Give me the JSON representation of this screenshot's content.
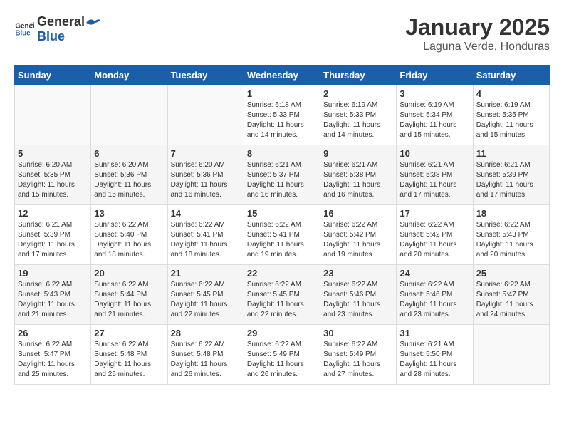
{
  "header": {
    "logo_general": "General",
    "logo_blue": "Blue",
    "month": "January 2025",
    "location": "Laguna Verde, Honduras"
  },
  "weekdays": [
    "Sunday",
    "Monday",
    "Tuesday",
    "Wednesday",
    "Thursday",
    "Friday",
    "Saturday"
  ],
  "weeks": [
    [
      {
        "day": "",
        "info": ""
      },
      {
        "day": "",
        "info": ""
      },
      {
        "day": "",
        "info": ""
      },
      {
        "day": "1",
        "info": "Sunrise: 6:18 AM\nSunset: 5:33 PM\nDaylight: 11 hours\nand 14 minutes."
      },
      {
        "day": "2",
        "info": "Sunrise: 6:19 AM\nSunset: 5:33 PM\nDaylight: 11 hours\nand 14 minutes."
      },
      {
        "day": "3",
        "info": "Sunrise: 6:19 AM\nSunset: 5:34 PM\nDaylight: 11 hours\nand 15 minutes."
      },
      {
        "day": "4",
        "info": "Sunrise: 6:19 AM\nSunset: 5:35 PM\nDaylight: 11 hours\nand 15 minutes."
      }
    ],
    [
      {
        "day": "5",
        "info": "Sunrise: 6:20 AM\nSunset: 5:35 PM\nDaylight: 11 hours\nand 15 minutes."
      },
      {
        "day": "6",
        "info": "Sunrise: 6:20 AM\nSunset: 5:36 PM\nDaylight: 11 hours\nand 15 minutes."
      },
      {
        "day": "7",
        "info": "Sunrise: 6:20 AM\nSunset: 5:36 PM\nDaylight: 11 hours\nand 16 minutes."
      },
      {
        "day": "8",
        "info": "Sunrise: 6:21 AM\nSunset: 5:37 PM\nDaylight: 11 hours\nand 16 minutes."
      },
      {
        "day": "9",
        "info": "Sunrise: 6:21 AM\nSunset: 5:38 PM\nDaylight: 11 hours\nand 16 minutes."
      },
      {
        "day": "10",
        "info": "Sunrise: 6:21 AM\nSunset: 5:38 PM\nDaylight: 11 hours\nand 17 minutes."
      },
      {
        "day": "11",
        "info": "Sunrise: 6:21 AM\nSunset: 5:39 PM\nDaylight: 11 hours\nand 17 minutes."
      }
    ],
    [
      {
        "day": "12",
        "info": "Sunrise: 6:21 AM\nSunset: 5:39 PM\nDaylight: 11 hours\nand 17 minutes."
      },
      {
        "day": "13",
        "info": "Sunrise: 6:22 AM\nSunset: 5:40 PM\nDaylight: 11 hours\nand 18 minutes."
      },
      {
        "day": "14",
        "info": "Sunrise: 6:22 AM\nSunset: 5:41 PM\nDaylight: 11 hours\nand 18 minutes."
      },
      {
        "day": "15",
        "info": "Sunrise: 6:22 AM\nSunset: 5:41 PM\nDaylight: 11 hours\nand 19 minutes."
      },
      {
        "day": "16",
        "info": "Sunrise: 6:22 AM\nSunset: 5:42 PM\nDaylight: 11 hours\nand 19 minutes."
      },
      {
        "day": "17",
        "info": "Sunrise: 6:22 AM\nSunset: 5:42 PM\nDaylight: 11 hours\nand 20 minutes."
      },
      {
        "day": "18",
        "info": "Sunrise: 6:22 AM\nSunset: 5:43 PM\nDaylight: 11 hours\nand 20 minutes."
      }
    ],
    [
      {
        "day": "19",
        "info": "Sunrise: 6:22 AM\nSunset: 5:43 PM\nDaylight: 11 hours\nand 21 minutes."
      },
      {
        "day": "20",
        "info": "Sunrise: 6:22 AM\nSunset: 5:44 PM\nDaylight: 11 hours\nand 21 minutes."
      },
      {
        "day": "21",
        "info": "Sunrise: 6:22 AM\nSunset: 5:45 PM\nDaylight: 11 hours\nand 22 minutes."
      },
      {
        "day": "22",
        "info": "Sunrise: 6:22 AM\nSunset: 5:45 PM\nDaylight: 11 hours\nand 22 minutes."
      },
      {
        "day": "23",
        "info": "Sunrise: 6:22 AM\nSunset: 5:46 PM\nDaylight: 11 hours\nand 23 minutes."
      },
      {
        "day": "24",
        "info": "Sunrise: 6:22 AM\nSunset: 5:46 PM\nDaylight: 11 hours\nand 23 minutes."
      },
      {
        "day": "25",
        "info": "Sunrise: 6:22 AM\nSunset: 5:47 PM\nDaylight: 11 hours\nand 24 minutes."
      }
    ],
    [
      {
        "day": "26",
        "info": "Sunrise: 6:22 AM\nSunset: 5:47 PM\nDaylight: 11 hours\nand 25 minutes."
      },
      {
        "day": "27",
        "info": "Sunrise: 6:22 AM\nSunset: 5:48 PM\nDaylight: 11 hours\nand 25 minutes."
      },
      {
        "day": "28",
        "info": "Sunrise: 6:22 AM\nSunset: 5:48 PM\nDaylight: 11 hours\nand 26 minutes."
      },
      {
        "day": "29",
        "info": "Sunrise: 6:22 AM\nSunset: 5:49 PM\nDaylight: 11 hours\nand 26 minutes."
      },
      {
        "day": "30",
        "info": "Sunrise: 6:22 AM\nSunset: 5:49 PM\nDaylight: 11 hours\nand 27 minutes."
      },
      {
        "day": "31",
        "info": "Sunrise: 6:21 AM\nSunset: 5:50 PM\nDaylight: 11 hours\nand 28 minutes."
      },
      {
        "day": "",
        "info": ""
      }
    ]
  ]
}
